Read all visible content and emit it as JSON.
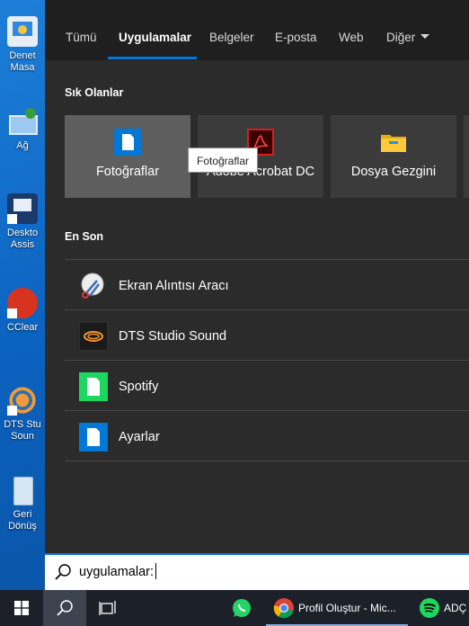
{
  "desktop": {
    "icons": [
      {
        "label": "Denet\nMasa",
        "icon": "control-panel-icon"
      },
      {
        "label": "Ağ",
        "icon": "network-icon"
      },
      {
        "label": "Deskto\nAssis",
        "icon": "desktop-assistant-icon"
      },
      {
        "label": "CClear",
        "icon": "ccleaner-icon"
      },
      {
        "label": "DTS Stu\nSoun",
        "icon": "dts-studio-sound-icon"
      },
      {
        "label": "Geri\nDönüş",
        "icon": "recycle-bin-icon"
      }
    ]
  },
  "tabs": [
    {
      "label": "Tümü",
      "active": false
    },
    {
      "label": "Uygulamalar",
      "active": true
    },
    {
      "label": "Belgeler",
      "active": false
    },
    {
      "label": "E-posta",
      "active": false
    },
    {
      "label": "Web",
      "active": false
    },
    {
      "label": "Diğer",
      "active": false
    }
  ],
  "favorites": {
    "title": "Sık Olanlar",
    "tiles": [
      {
        "label": "Fotoğraflar",
        "icon": "document-icon"
      },
      {
        "label": "Adobe Acrobat DC",
        "icon": "acrobat-icon"
      },
      {
        "label": "Dosya Gezgini",
        "icon": "folder-icon"
      }
    ],
    "tooltip": "Fotoğraflar"
  },
  "recent": {
    "title": "En Son",
    "items": [
      {
        "label": "Ekran Alıntısı Aracı",
        "icon": "snipping-tool-icon"
      },
      {
        "label": "DTS Studio Sound",
        "icon": "dts-icon"
      },
      {
        "label": "Spotify",
        "icon": "document-icon"
      },
      {
        "label": "Ayarlar",
        "icon": "document-icon"
      }
    ]
  },
  "search": {
    "value": "uygulamalar:"
  },
  "taskbar": {
    "apps": [
      {
        "label": "Profil Oluştur - Mic...",
        "icon": "chrome-icon"
      },
      {
        "label": "ADÇ L",
        "icon": "spotify-icon"
      }
    ]
  },
  "colors": {
    "accent": "#0078d7",
    "panel": "#2b2b2b",
    "tile": "#3b3b3b",
    "tile_hover": "#5e5e5e"
  }
}
